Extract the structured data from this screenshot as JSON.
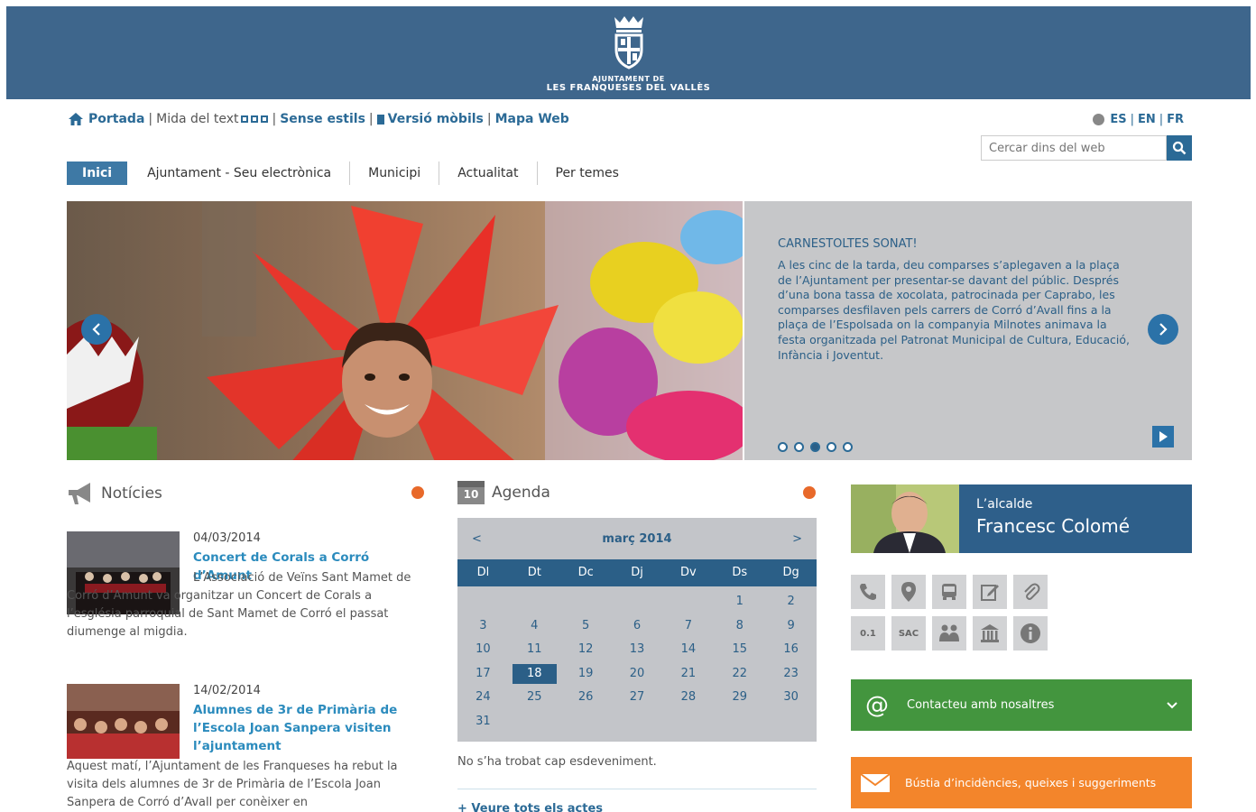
{
  "header": {
    "logo_line1": "AJUNTAMENT DE",
    "logo_line2": "LES FRANQUESES DEL VALLÈS"
  },
  "topbar": {
    "home": "Portada",
    "text_size": "Mida del text",
    "no_styles": "Sense estils",
    "mobile": "Versió mòbils",
    "sitemap": "Mapa Web"
  },
  "langs": [
    "ES",
    "EN",
    "FR"
  ],
  "search": {
    "placeholder": "Cercar dins del web"
  },
  "nav": [
    "Inici",
    "Ajuntament - Seu electrònica",
    "Municipi",
    "Actualitat",
    "Per temes"
  ],
  "slider": {
    "title": "CARNESTOLTES SONAT!",
    "body": "A les cinc de la tarda, deu comparses s’aplegaven a la plaça de l’Ajuntament per presentar-se davant del públic. Després d’una bona tassa de xocolata, patrocinada per Caprabo, les comparses desfilaven pels carrers de Corró d’Avall fins a la plaça de l’Espolsada on la companyia Milnotes animava la festa organitzada pel Patronat Municipal de Cultura, Educació, Infància i Joventut.",
    "dots": 5,
    "active_dot": 3
  },
  "news": {
    "title": "Notícies",
    "items": [
      {
        "date": "04/03/2014",
        "title": "Concert de Corals a Corró d’Amunt",
        "text": "L’Associació de Veïns Sant Mamet de Corró d’Amunt va organitzar un Concert de Corals a l’església parroquial de Sant Mamet de Corró el passat diumenge al migdia."
      },
      {
        "date": "14/02/2014",
        "title": "Alumnes de 3r de Primària de l’Escola Joan Sanpera visiten l’ajuntament",
        "text": "Aquest matí, l’Ajuntament de les Franqueses ha rebut la visita dels alumnes de 3r de Primària de l’Escola Joan Sanpera de Corró d’Avall per conèixer en"
      }
    ]
  },
  "agenda": {
    "title": "Agenda",
    "icon_day": "10",
    "month": "març 2014",
    "prev": "<",
    "next": ">",
    "weekdays": [
      "Dl",
      "Dt",
      "Dc",
      "Dj",
      "Dv",
      "Ds",
      "Dg"
    ],
    "weeks": [
      [
        "",
        "",
        "",
        "",
        "",
        "1",
        "2"
      ],
      [
        "3",
        "4",
        "5",
        "6",
        "7",
        "8",
        "9"
      ],
      [
        "10",
        "11",
        "12",
        "13",
        "14",
        "15",
        "16"
      ],
      [
        "17",
        "18",
        "19",
        "20",
        "21",
        "22",
        "23"
      ],
      [
        "24",
        "25",
        "26",
        "27",
        "28",
        "29",
        "30"
      ],
      [
        "31",
        "",
        "",
        "",
        "",
        "",
        ""
      ]
    ],
    "today": "18",
    "no_events": "No s’ha trobat cap esdeveniment.",
    "see_all": "Veure tots els actes"
  },
  "mayor": {
    "label": "L’alcalde",
    "name": "Francesc Colomé"
  },
  "quick_icons_row2_text": [
    "0.1",
    "SAC"
  ],
  "contact": {
    "label": "Contacteu amb nosaltres"
  },
  "bustia": {
    "label": "Bústia d’incidències, queixes i suggeriments"
  },
  "colors": {
    "header_blue": "#3e668c",
    "link_blue": "#2b6a96",
    "green": "#43953e",
    "orange": "#f3852b",
    "rss_orange": "#e8692a"
  }
}
